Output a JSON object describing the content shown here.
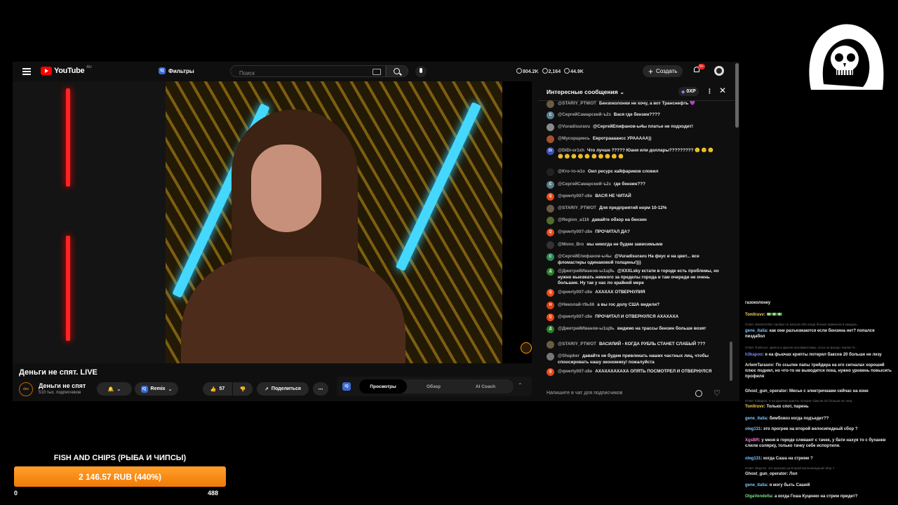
{
  "header": {
    "logo_text": "YouTube",
    "logo_region": "RU",
    "filters_label": "Фильтры",
    "iq_badge": "IQ",
    "search_placeholder": "Поиск",
    "stats": [
      "804.2K",
      "2,164",
      "44.9K"
    ],
    "create_label": "Создать",
    "notifications_count": "9+"
  },
  "video": {
    "title": "Деньги не спят. LIVE",
    "channel_name": "Деньги не спят",
    "channel_avatar_text": "dze",
    "subscribers": "510 тыс. подписчиков",
    "remix_label": "Remix",
    "likes": "57",
    "share_label": "Поделиться",
    "tabs": [
      "Просмотры",
      "Обзор",
      "AI Coach"
    ],
    "active_tab": "Просмотры"
  },
  "chat": {
    "title": "Интересные сообщения",
    "xp": "0XP",
    "input_placeholder": "Напишите в чат для подписчиков",
    "messages": [
      {
        "author": "@STARIY_PTWOT",
        "text": "Бензоколонки не хочу, а вот Транснефть 💜",
        "avatar": "",
        "color": "#6b5a45"
      },
      {
        "author": "@СергейСамарский-ъ2з",
        "text": "Вася где бензин????",
        "avatar": "С",
        "color": "#5c7d8a"
      },
      {
        "author": "@Vuradisuravu",
        "text": "@СергейЕпифанов-ы4ы платье не подходит!",
        "avatar": "",
        "color": "#8a8a8a"
      },
      {
        "author": "@Мусорщиесь",
        "text": "Евротраааансс УРААААА))",
        "avatar": "",
        "color": "#a0522d"
      },
      {
        "author": "@DiDi-or1xh",
        "text": "Что лучше ????? Юани или доллары????????? 🙂 🙂 🙂 🙂 🙂 🙂 🙂 🙂 🙂 🙂 🙂 🙂 🙂",
        "avatar": "Di",
        "color": "#3f51b5"
      },
      {
        "author": "@Кто-то-я1о",
        "text": "Оил ресурс кайфариков словил",
        "avatar": "",
        "color": "#222222"
      },
      {
        "author": "@СергейСамарский-ъ2з",
        "text": "где бензин???",
        "avatar": "С",
        "color": "#5c7d8a"
      },
      {
        "author": "@qwerty007-z8e",
        "text": "ВАСЯ НЕ ЧИТАЙ",
        "avatar": "Q",
        "color": "#e64a19"
      },
      {
        "author": "@STARIY_PTWOT",
        "text": "Для предприятий норм 10-12%",
        "avatar": "",
        "color": "#6b5a45"
      },
      {
        "author": "@Region_a116",
        "text": "давайте обзор на бензин",
        "avatar": "",
        "color": "#556b2f"
      },
      {
        "author": "@qwerty007-z8e",
        "text": "ПРОЧИТАЛ ДА?",
        "avatar": "Q",
        "color": "#e64a19"
      },
      {
        "author": "@Mono_Bro",
        "text": "мы никогда не будем зависимыми",
        "avatar": "",
        "color": "#333333"
      },
      {
        "author": "@СергейЕпифанов-ы4ы",
        "text": "@Vuradisuravu На фкус и на цвет... все фломастеры одинаковой толщины!)))",
        "avatar": "С",
        "color": "#2e8b57"
      },
      {
        "author": "@ДмитрийИванов-ы1щ9ь",
        "text": "@XXXLsky кстати в городе есть проблемы, но нужно выезжать немного за пределы города и там очереди не очень большие. Ну так у нас по крайней мере",
        "avatar": "Д",
        "color": "#2e7d32"
      },
      {
        "author": "@qwerty007-z8e",
        "text": "АХАХАХ ОТВЕРНУЛИЯ",
        "avatar": "Q",
        "color": "#e64a19"
      },
      {
        "author": "@Николай-т9ь66",
        "text": "а вы гос долу США видели?",
        "avatar": "Н",
        "color": "#d84315"
      },
      {
        "author": "@qwerty007-z8e",
        "text": "ПРОЧИТАЛ И ОТВЕРНУЛСЯ АХАХАХА",
        "avatar": "Q",
        "color": "#e64a19"
      },
      {
        "author": "@ДмитрийИванов-ы1щ9ь",
        "text": "видимо на трассы бензин больше возят",
        "avatar": "Д",
        "color": "#2e7d32"
      },
      {
        "author": "@STARIY_PTWOT",
        "text": "ВАСИЛИЙ - КОГДА РУБЛЬ СТАНЕТ СЛАБЫЙ ???",
        "avatar": "",
        "color": "#6b5a45"
      },
      {
        "author": "@Shapker",
        "text": "давайте не будем привлекать наших частных лиц, чтобы спонсировать нашу экономику! пожалуйста",
        "avatar": "",
        "color": "#777777"
      },
      {
        "author": "@qwerty007-z8e",
        "text": "АХАХАХАХАХА ОПЯТЬ ПОСМОТРЕЛ И ОТВЕРНУЛСЯ",
        "avatar": "Q",
        "color": "#e64a19"
      }
    ]
  },
  "overlay_chat": [
    {
      "name": "",
      "text": "газоколонку",
      "color": "#eeeeee",
      "reply": ""
    },
    {
      "name": "Tonitruvv",
      "text": "💵💵💵",
      "color": "#ffd54f",
      "reply": ""
    },
    {
      "name": "",
      "text": "",
      "color": "#777777",
      "reply": "Ответ ubestrochila: пробки по метров 400 когда бензин привезли в каждом..."
    },
    {
      "name": "gene_italia",
      "text": "как они разъезжаются если бензина нет? попался пиздабол",
      "color": "#7ec8ff",
      "reply": ""
    },
    {
      "name": "",
      "text": "",
      "color": "#777777",
      "reply": "Ответ Tonitruvv: крипта и фьючи несовместимы, если на фондо теряют 9..."
    },
    {
      "name": "h3kapoo",
      "text": "я на фьючах крипты потерял баксов 20 больше не лезу",
      "color": "#7b8cff",
      "reply": ""
    },
    {
      "name": "ArtemTarasov",
      "text": "По ссылке папы трейдера на его сигналах хороший плюс поднял, но что-то не выводится пока, нужно уровень повысить профиля",
      "color": "#eeeeee",
      "reply": ""
    },
    {
      "name": "Ghost_gun_operator",
      "text": "Месье с электричками сейчас на коне",
      "color": "#eeeeee",
      "reply": ""
    },
    {
      "name": "",
      "text": "",
      "color": "#777777",
      "reply": "Ответ h3kapoo: я на фьючах крипты потерял баксов 20 больше не лезу"
    },
    {
      "name": "Tonitruvv",
      "text": "Только спот, парень",
      "color": "#ffd54f",
      "reply": ""
    },
    {
      "name": "gene_italia",
      "text": "бимбовоз когда подъедет??",
      "color": "#7ec8ff",
      "reply": ""
    },
    {
      "name": "oleg131",
      "text": "это прогрев на второй велосипедный сбор ?",
      "color": "#7ec8ff",
      "reply": ""
    },
    {
      "name": "XgsBR",
      "text": "у меня в городе сливают с тачек, у бати нахуя то с буханки слили солярку, только тачку себе испортили.",
      "color": "#ff7ad9",
      "reply": ""
    },
    {
      "name": "oleg131",
      "text": "когда Саша на стриме ?",
      "color": "#7ec8ff",
      "reply": ""
    },
    {
      "name": "",
      "text": "",
      "color": "#777777",
      "reply": "Ответ oleg131: это прогрев на второй велосипедный сбор ?"
    },
    {
      "name": "Ghost_gun_operator",
      "text": "Лол",
      "color": "#eeeeee",
      "reply": ""
    },
    {
      "name": "gene_italia",
      "text": "я могу быть Сашей",
      "color": "#7ec8ff",
      "reply": ""
    },
    {
      "name": "OlgaVendetta",
      "text": "а когда Гоша Куценко на стрим придет?",
      "color": "#7ee07e",
      "reply": ""
    }
  ],
  "goal": {
    "title": "FISH AND CHIPS (РЫБА И ЧИПСЫ)",
    "amount_text": "2 146.57 RUB (440%)",
    "min": "0",
    "max": "488",
    "progress": 1.0
  },
  "colors": {
    "accent_orange": "#f58a0f",
    "youtube_red": "#ff0000",
    "background": "#000000"
  }
}
